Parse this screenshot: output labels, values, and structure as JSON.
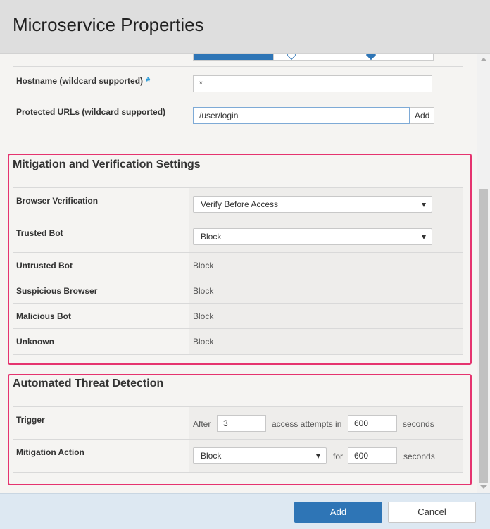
{
  "dialog": {
    "title": "Microservice Properties"
  },
  "general": {
    "hostname_label": "Hostname (wildcard supported)",
    "hostname_required": "*",
    "hostname_value": "*",
    "urls_label": "Protected URLs (wildcard supported)",
    "urls_value": "/user/login",
    "add_url_label": "Add"
  },
  "mitigation": {
    "title": "Mitigation and Verification Settings",
    "browser_verification": {
      "label": "Browser Verification",
      "value": "Verify Before Access"
    },
    "trusted_bot": {
      "label": "Trusted Bot",
      "value": "Block"
    },
    "untrusted_bot": {
      "label": "Untrusted Bot",
      "value": "Block"
    },
    "suspicious_browser": {
      "label": "Suspicious Browser",
      "value": "Block"
    },
    "malicious_bot": {
      "label": "Malicious Bot",
      "value": "Block"
    },
    "unknown": {
      "label": "Unknown",
      "value": "Block"
    }
  },
  "threat": {
    "title": "Automated Threat Detection",
    "trigger": {
      "label": "Trigger",
      "after_text": "After",
      "attempts_value": "3",
      "attempts_text": "access attempts in",
      "seconds_value": "600",
      "seconds_text": "seconds"
    },
    "mitigation_action": {
      "label": "Mitigation Action",
      "value": "Block",
      "for_text": "for",
      "seconds_value": "600",
      "seconds_text": "seconds"
    }
  },
  "footer": {
    "add_label": "Add",
    "cancel_label": "Cancel"
  },
  "colors": {
    "accent": "#2e75b6",
    "highlight": "#e5336f"
  }
}
